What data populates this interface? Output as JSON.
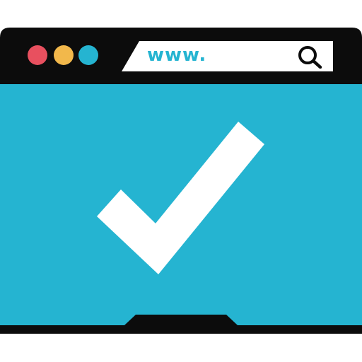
{
  "address_bar": {
    "text": "www."
  },
  "icons": {
    "search": "search-icon",
    "status": "checkmark-icon"
  },
  "colors": {
    "frame": "#0c0c0c",
    "screen": "#25b4d1",
    "address_bar": "#ffffff",
    "url_text": "#25b4d1",
    "traffic_red": "#e8505f",
    "traffic_yellow": "#f2b84b",
    "traffic_blue": "#25b4d1",
    "checkmark": "#ffffff"
  }
}
